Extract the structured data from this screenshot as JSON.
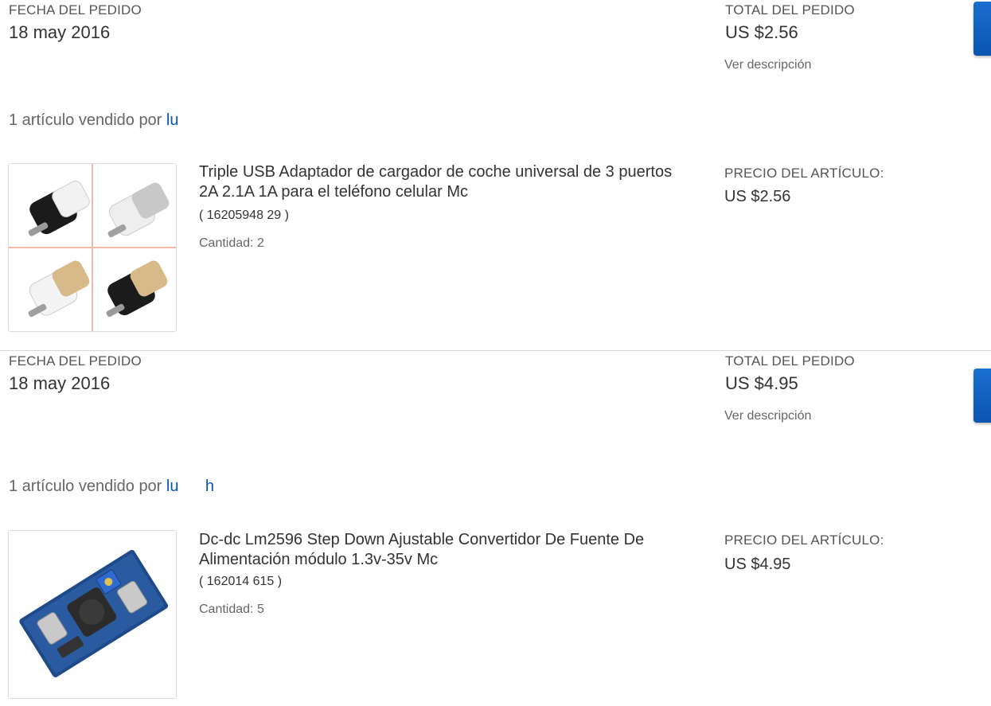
{
  "orders": [
    {
      "date_label": "FECHA DEL PEDIDO",
      "date": "18 may 2016",
      "total_label": "TOTAL DEL PEDIDO",
      "total": "US $2.56",
      "view_description": "Ver descripción",
      "sold_by_text": "1 artículo vendido por ",
      "seller": "lu",
      "item": {
        "title": "Triple USB Adaptador de cargador de coche universal de 3 puertos 2A 2.1A 1A para el teléfono celular Mc",
        "number": "( 16205948  29 )",
        "quantity": "Cantidad: 2",
        "price_label": "PRECIO DEL ARTÍCULO:",
        "price": "US $2.56",
        "image_icon": "usb-car-charger-image"
      }
    },
    {
      "date_label": "FECHA DEL PEDIDO",
      "date": "18 may 2016",
      "total_label": "TOTAL DEL PEDIDO",
      "total": "US $4.95",
      "view_description": "Ver descripción",
      "sold_by_text": "1 artículo vendido por ",
      "seller": "lu      h",
      "item": {
        "title": "Dc-dc Lm2596 Step Down Ajustable Convertidor De Fuente De Alimentación módulo 1.3v-35v Mc",
        "number": "( 162014  615 )",
        "quantity": "Cantidad: 5",
        "price_label": "PRECIO DEL ARTÍCULO:",
        "price": "US $4.95",
        "image_icon": "dc-converter-board-image"
      }
    }
  ],
  "colors": {
    "link": "#0654ba",
    "button": "#0a55b0",
    "divider": "#d6d6d6"
  }
}
